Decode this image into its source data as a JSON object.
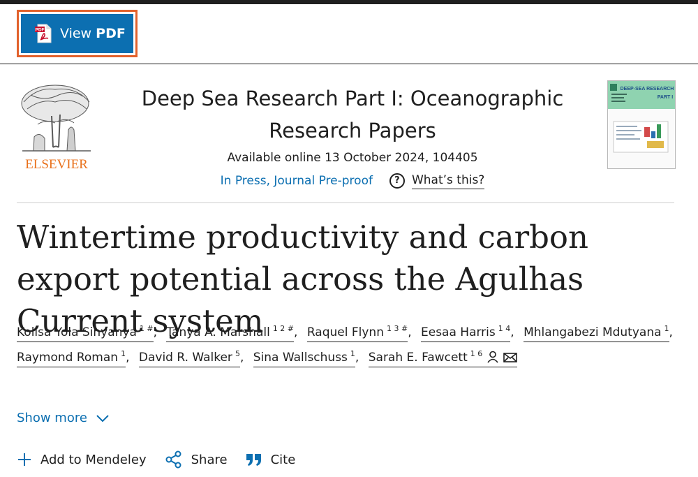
{
  "toolbar": {
    "pdf_button_prefix": "View ",
    "pdf_button_strong": "PDF",
    "pdf_badge": "PDF"
  },
  "publisher": {
    "logo_text": "ELSEVIER"
  },
  "journal": {
    "title": "Deep Sea Research Part I: Oceanographic Research Papers",
    "available": "Available online 13 October 2024, 104405",
    "status": "In Press, Journal Pre-proof",
    "help_label": "What’s this?",
    "help_glyph": "?",
    "cover_heading": "DEEP-SEA RESEARCH",
    "cover_subheading": "PART I"
  },
  "article": {
    "title": "Wintertime productivity and carbon export potential across the Agulhas Current system"
  },
  "authors": [
    {
      "name": "Kolisa Yola Sinyanya",
      "sup": "1 #",
      "sep": ","
    },
    {
      "name": "Tanya A. Marshall",
      "sup": "1 2 #",
      "sep": ","
    },
    {
      "name": "Raquel Flynn",
      "sup": "1 3 #",
      "sep": ","
    },
    {
      "name": "Eesaa Harris",
      "sup": "1 4",
      "sep": ","
    },
    {
      "name": "Mhlangabezi Mdutyana",
      "sup": "1",
      "sep": ","
    },
    {
      "name": "Raymond Roman",
      "sup": "1",
      "sep": ","
    },
    {
      "name": "David R. Walker",
      "sup": "5",
      "sep": ","
    },
    {
      "name": "Sina Wallschuss",
      "sup": "1",
      "sep": ","
    },
    {
      "name": "Sarah E. Fawcett",
      "sup": "1 6",
      "sep": ""
    }
  ],
  "show_more": "Show more",
  "actions": {
    "mendeley": "Add to Mendeley",
    "share": "Share",
    "cite": "Cite"
  },
  "colors": {
    "accent": "#0c6fb1",
    "focus": "#e2622d",
    "elsevier": "#e9711c"
  },
  "icons": [
    "pdf-icon",
    "help-icon",
    "person-icon",
    "envelope-icon",
    "chevron-down-icon",
    "plus-icon",
    "share-icon",
    "quote-icon"
  ]
}
